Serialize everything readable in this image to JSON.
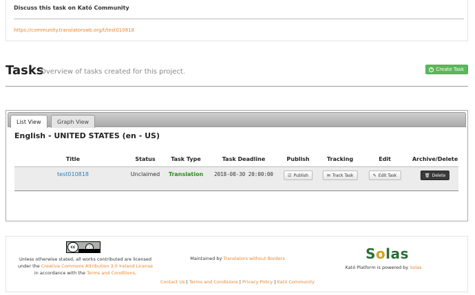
{
  "discuss": {
    "title": "Discuss this task on Kató Community",
    "link": "https://community.translatorswb.org/t/test010818"
  },
  "tasks": {
    "title": "Tasks",
    "subtitle": "Overview of tasks created for this project.",
    "create_label": "Create Task"
  },
  "tabs": [
    "List View",
    "Graph View"
  ],
  "language_heading": "English - UNITED STATES (en - US)",
  "table": {
    "headers": [
      "Title",
      "Status",
      "Task Type",
      "Task Deadline",
      "Publish",
      "Tracking",
      "Edit",
      "Archive/Delete"
    ],
    "rows": [
      {
        "title": "test010818",
        "status": "Unclaimed",
        "type": "Translation",
        "deadline": "2018-08-30 20:00:00",
        "publish": "Publish",
        "tracking": "Track Task",
        "edit": "Edit Task",
        "delete": "Delete"
      }
    ]
  },
  "footer": {
    "license_pre": "Unless otherwise stated, all works contributed are licensed under the",
    "license_link": "Creative Commons Attribution 3.0 Ireland License",
    "license_mid": "in accordance with the",
    "terms_link": "Terms and Conditions",
    "license_end": ".",
    "maintained_pre": "Maintained by",
    "maintained_link": "Translators without Borders",
    "logo": "Solas",
    "powered_pre": "Kató Platform is powered by",
    "powered_link": "Solas",
    "links": [
      "Contact Us",
      "Terms and Condisions",
      "Privacy Policy",
      "Kató Community"
    ],
    "link_separator": "|"
  },
  "colors": {
    "link": "#e8852b",
    "create_button": "#5cb85c",
    "task_type": "#2e8b1f",
    "title_link": "#2a7fbd"
  }
}
